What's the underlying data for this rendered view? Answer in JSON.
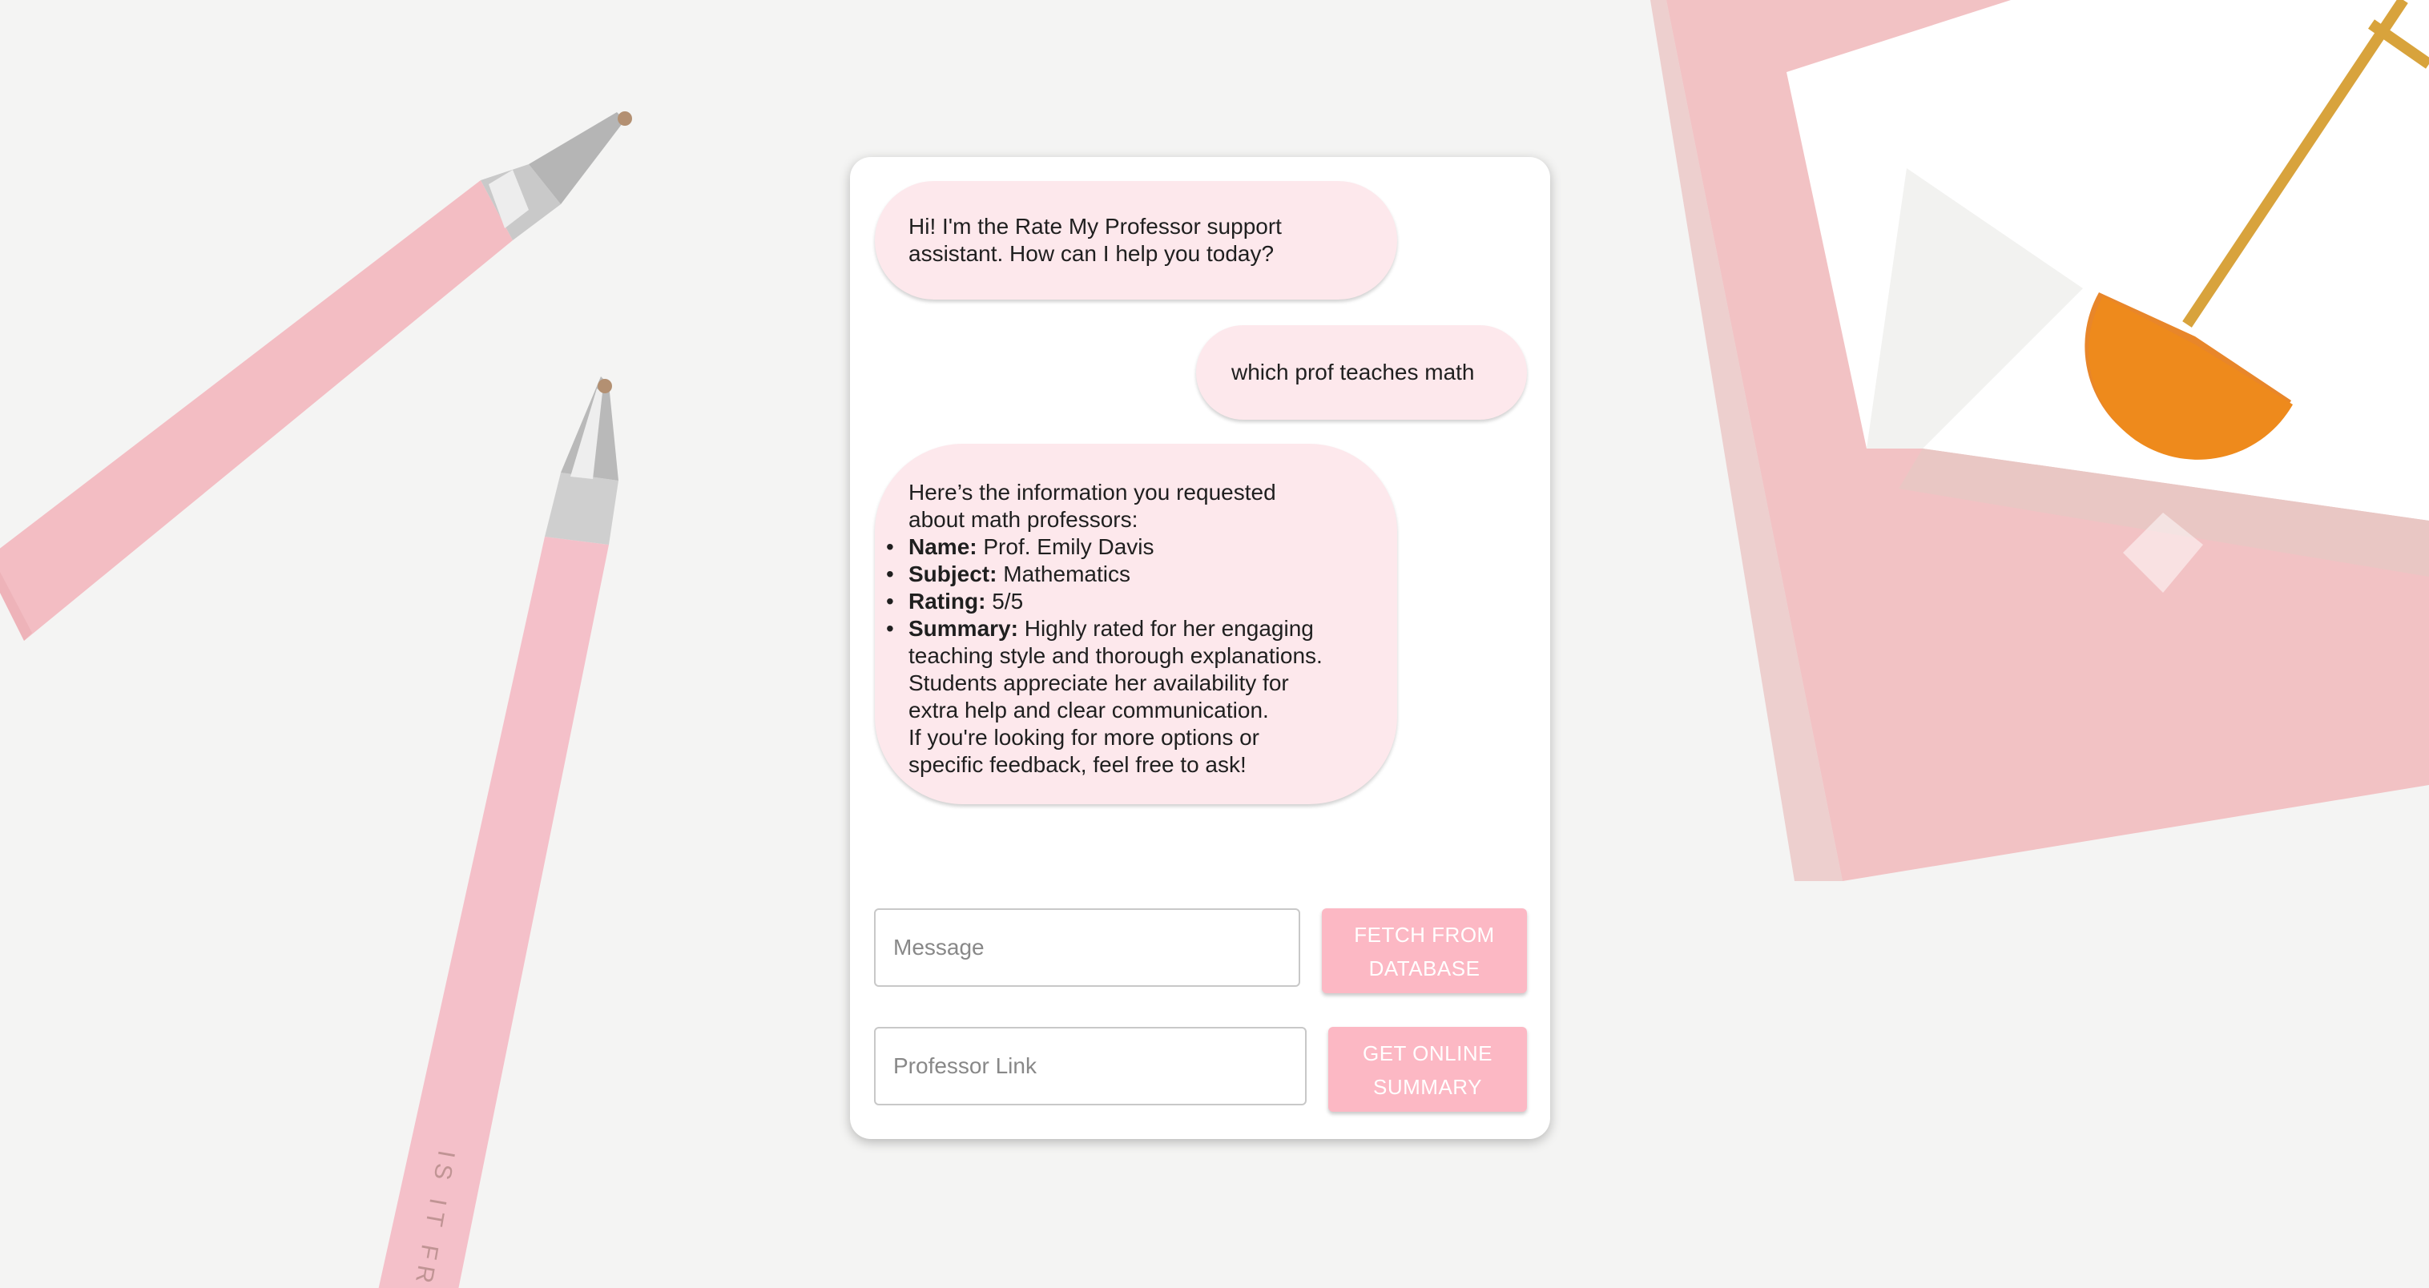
{
  "colors": {
    "bubble": "#fde8ec",
    "button": "#fcb8c4",
    "button_text": "#ffffff",
    "pen": "#f3bdc3"
  },
  "chat": {
    "messages": [
      {
        "role": "assistant",
        "line1": "Hi! I'm the Rate My Professor support",
        "line2": "assistant. How can I help you today?"
      },
      {
        "role": "user",
        "text": "which prof teaches math"
      },
      {
        "role": "assistant",
        "intro1": "Here’s the information you requested",
        "intro2": "about math professors:",
        "items": [
          {
            "label": "Name:",
            "value": "Prof. Emily Davis"
          },
          {
            "label": "Subject:",
            "value": "Mathematics"
          },
          {
            "label": "Rating:",
            "value": "5/5"
          },
          {
            "label": "Summary:",
            "value": "Highly rated for her engaging",
            "more1": "teaching style and thorough explanations.",
            "more2": "Students appreciate her availability for",
            "more3": "extra help and clear communication."
          }
        ],
        "outro1": "If you're looking for more options or",
        "outro2": "specific feedback, feel free to ask!"
      }
    ]
  },
  "inputs": {
    "message_placeholder": "Message",
    "link_placeholder": "Professor Link"
  },
  "buttons": {
    "fetch_line1": "FETCH FROM",
    "fetch_line2": "DATABASE",
    "summary_line1": "GET ONLINE",
    "summary_line2": "SUMMARY"
  },
  "background": {
    "pen_text": "IS IT FR"
  }
}
